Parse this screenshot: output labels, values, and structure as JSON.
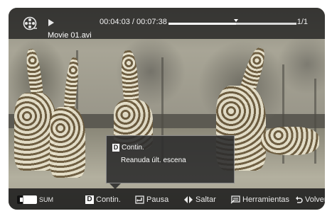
{
  "top": {
    "time": "00:04:03 / 00:07:38",
    "track": "1/1",
    "filename": "Movie 01.avi",
    "progress_fraction": 0.53
  },
  "popup": {
    "key": "D",
    "title": "Contin.",
    "message": "Reanuda últ. escena"
  },
  "bottom": {
    "sum_label": "SUM",
    "contin_key": "D",
    "contin_label": "Contin.",
    "pause_label": "Pausa",
    "skip_label": "Saltar",
    "tools_label": "Herramientas",
    "back_label": "Volver"
  },
  "icons": {
    "media": "film-reel-icon",
    "play": "play-icon",
    "pause": "enter-icon",
    "skip": "left-right-arrows-icon",
    "tools": "tools-icon",
    "back": "return-icon"
  }
}
